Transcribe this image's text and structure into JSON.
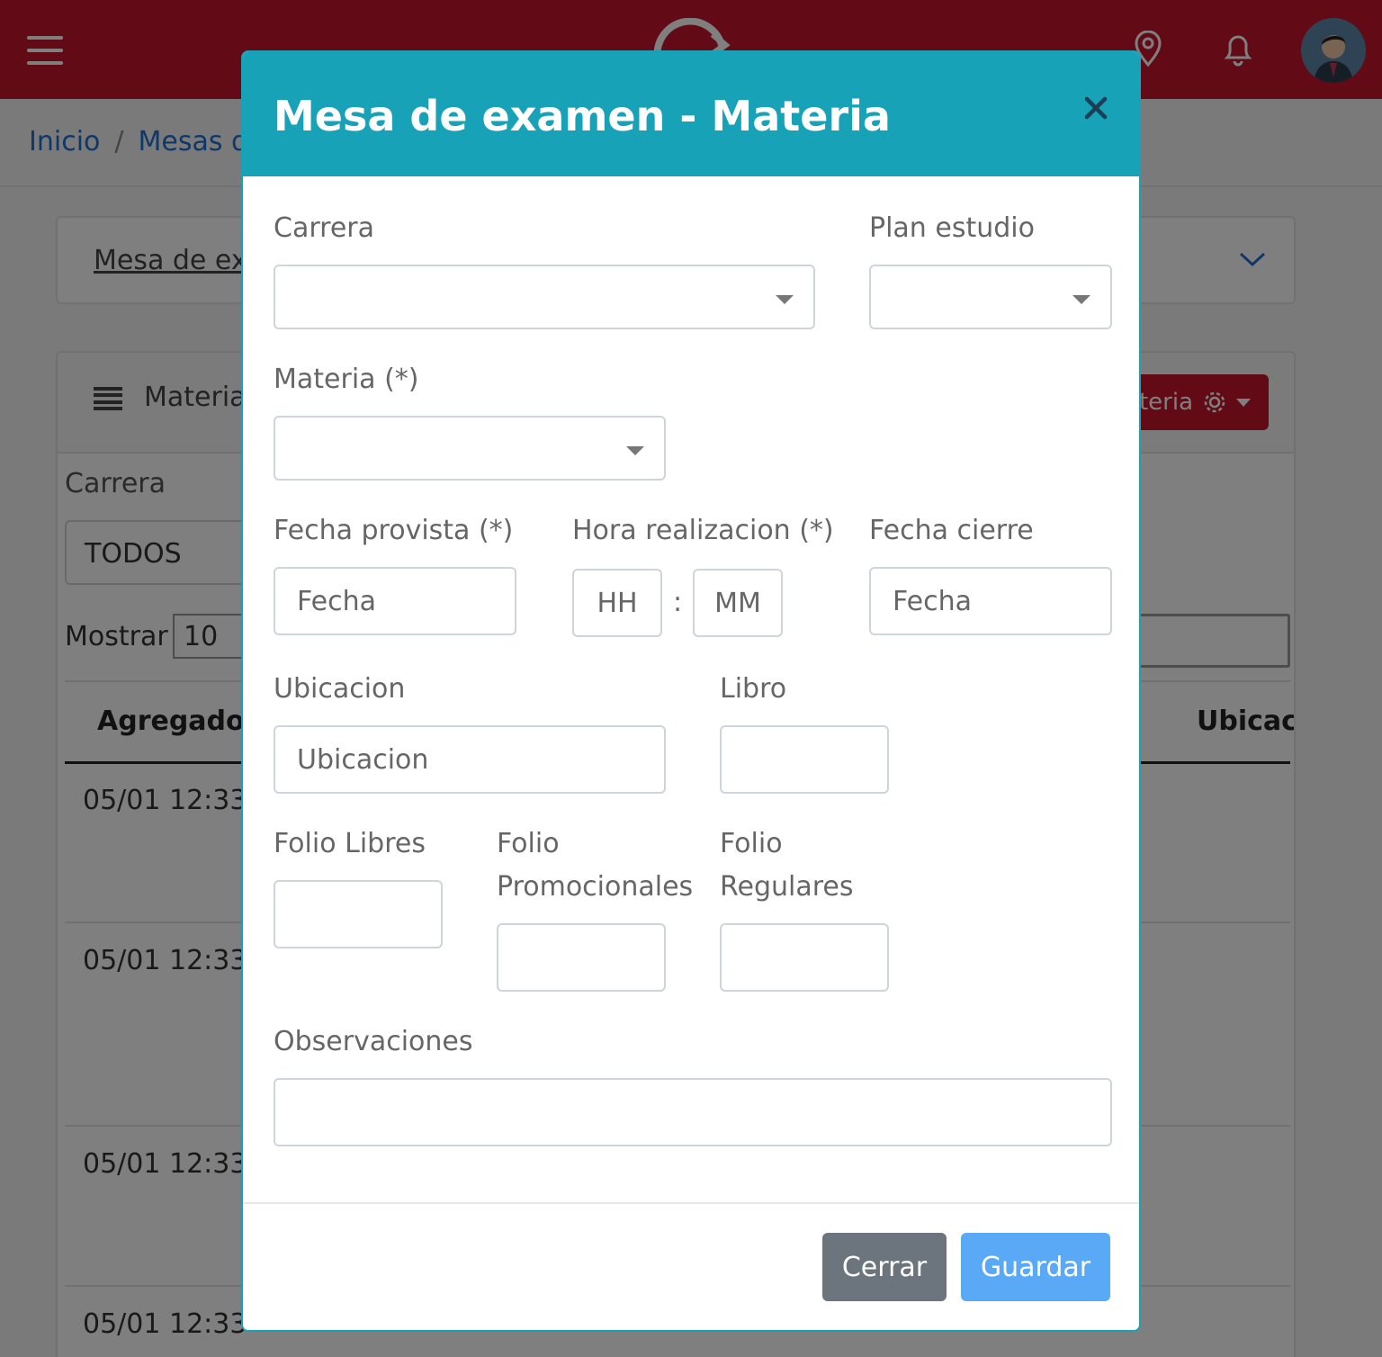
{
  "topbar": {
    "menu_icon": "hamburger-icon",
    "logo_icon": "logo-icon",
    "location_icon": "map-pin-icon",
    "bell_icon": "bell-icon",
    "brand_color": "#c4142c"
  },
  "breadcrumb": {
    "home": "Inicio",
    "separator": "/",
    "current": "Mesas de examen"
  },
  "filter_card": {
    "title": "Mesa de examen"
  },
  "materias_card": {
    "title": "Materias",
    "action_button": "Materia",
    "carrera_label": "Carrera",
    "carrera_value": "TODOS",
    "mostrar_label": "Mostrar",
    "mostrar_value": "10",
    "col_agregado": "Agregado",
    "col_ubicacion": "Ubicacion",
    "rows": [
      "05/01 12:33",
      "05/01 12:33",
      "05/01 12:33",
      "05/01 12:33"
    ]
  },
  "modal": {
    "title": "Mesa de examen - Materia",
    "close_icon": "close-icon",
    "header_color": "#17a2b8",
    "fields": {
      "carrera_label": "Carrera",
      "plan_label": "Plan estudio",
      "materia_label": "Materia (*)",
      "fecha_provista_label": "Fecha provista (*)",
      "fecha_provista_placeholder": "Fecha",
      "hora_label": "Hora realizacion (*)",
      "hh_placeholder": "HH",
      "colon": ":",
      "mm_placeholder": "MM",
      "fecha_cierre_label": "Fecha cierre",
      "fecha_cierre_placeholder": "Fecha",
      "ubicacion_label": "Ubicacion",
      "ubicacion_placeholder": "Ubicacion",
      "libro_label": "Libro",
      "folio_libres_label": "Folio Libres",
      "folio_promo_line1": "Folio",
      "folio_promo_line2": "Promocionales",
      "folio_reg_line1": "Folio",
      "folio_reg_line2": "Regulares",
      "observaciones_label": "Observaciones"
    },
    "buttons": {
      "close": "Cerrar",
      "save": "Guardar"
    }
  }
}
